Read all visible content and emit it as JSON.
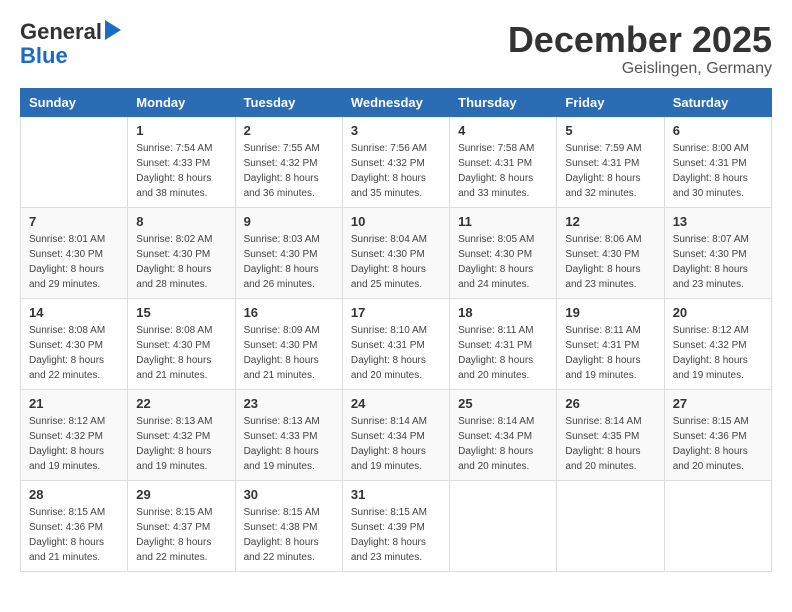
{
  "header": {
    "logo_general": "General",
    "logo_blue": "Blue",
    "month_title": "December 2025",
    "location": "Geislingen, Germany"
  },
  "days_of_week": [
    "Sunday",
    "Monday",
    "Tuesday",
    "Wednesday",
    "Thursday",
    "Friday",
    "Saturday"
  ],
  "weeks": [
    [
      {
        "day": "",
        "info": ""
      },
      {
        "day": "1",
        "info": "Sunrise: 7:54 AM\nSunset: 4:33 PM\nDaylight: 8 hours\nand 38 minutes."
      },
      {
        "day": "2",
        "info": "Sunrise: 7:55 AM\nSunset: 4:32 PM\nDaylight: 8 hours\nand 36 minutes."
      },
      {
        "day": "3",
        "info": "Sunrise: 7:56 AM\nSunset: 4:32 PM\nDaylight: 8 hours\nand 35 minutes."
      },
      {
        "day": "4",
        "info": "Sunrise: 7:58 AM\nSunset: 4:31 PM\nDaylight: 8 hours\nand 33 minutes."
      },
      {
        "day": "5",
        "info": "Sunrise: 7:59 AM\nSunset: 4:31 PM\nDaylight: 8 hours\nand 32 minutes."
      },
      {
        "day": "6",
        "info": "Sunrise: 8:00 AM\nSunset: 4:31 PM\nDaylight: 8 hours\nand 30 minutes."
      }
    ],
    [
      {
        "day": "7",
        "info": "Sunrise: 8:01 AM\nSunset: 4:30 PM\nDaylight: 8 hours\nand 29 minutes."
      },
      {
        "day": "8",
        "info": "Sunrise: 8:02 AM\nSunset: 4:30 PM\nDaylight: 8 hours\nand 28 minutes."
      },
      {
        "day": "9",
        "info": "Sunrise: 8:03 AM\nSunset: 4:30 PM\nDaylight: 8 hours\nand 26 minutes."
      },
      {
        "day": "10",
        "info": "Sunrise: 8:04 AM\nSunset: 4:30 PM\nDaylight: 8 hours\nand 25 minutes."
      },
      {
        "day": "11",
        "info": "Sunrise: 8:05 AM\nSunset: 4:30 PM\nDaylight: 8 hours\nand 24 minutes."
      },
      {
        "day": "12",
        "info": "Sunrise: 8:06 AM\nSunset: 4:30 PM\nDaylight: 8 hours\nand 23 minutes."
      },
      {
        "day": "13",
        "info": "Sunrise: 8:07 AM\nSunset: 4:30 PM\nDaylight: 8 hours\nand 23 minutes."
      }
    ],
    [
      {
        "day": "14",
        "info": "Sunrise: 8:08 AM\nSunset: 4:30 PM\nDaylight: 8 hours\nand 22 minutes."
      },
      {
        "day": "15",
        "info": "Sunrise: 8:08 AM\nSunset: 4:30 PM\nDaylight: 8 hours\nand 21 minutes."
      },
      {
        "day": "16",
        "info": "Sunrise: 8:09 AM\nSunset: 4:30 PM\nDaylight: 8 hours\nand 21 minutes."
      },
      {
        "day": "17",
        "info": "Sunrise: 8:10 AM\nSunset: 4:31 PM\nDaylight: 8 hours\nand 20 minutes."
      },
      {
        "day": "18",
        "info": "Sunrise: 8:11 AM\nSunset: 4:31 PM\nDaylight: 8 hours\nand 20 minutes."
      },
      {
        "day": "19",
        "info": "Sunrise: 8:11 AM\nSunset: 4:31 PM\nDaylight: 8 hours\nand 19 minutes."
      },
      {
        "day": "20",
        "info": "Sunrise: 8:12 AM\nSunset: 4:32 PM\nDaylight: 8 hours\nand 19 minutes."
      }
    ],
    [
      {
        "day": "21",
        "info": "Sunrise: 8:12 AM\nSunset: 4:32 PM\nDaylight: 8 hours\nand 19 minutes."
      },
      {
        "day": "22",
        "info": "Sunrise: 8:13 AM\nSunset: 4:32 PM\nDaylight: 8 hours\nand 19 minutes."
      },
      {
        "day": "23",
        "info": "Sunrise: 8:13 AM\nSunset: 4:33 PM\nDaylight: 8 hours\nand 19 minutes."
      },
      {
        "day": "24",
        "info": "Sunrise: 8:14 AM\nSunset: 4:34 PM\nDaylight: 8 hours\nand 19 minutes."
      },
      {
        "day": "25",
        "info": "Sunrise: 8:14 AM\nSunset: 4:34 PM\nDaylight: 8 hours\nand 20 minutes."
      },
      {
        "day": "26",
        "info": "Sunrise: 8:14 AM\nSunset: 4:35 PM\nDaylight: 8 hours\nand 20 minutes."
      },
      {
        "day": "27",
        "info": "Sunrise: 8:15 AM\nSunset: 4:36 PM\nDaylight: 8 hours\nand 20 minutes."
      }
    ],
    [
      {
        "day": "28",
        "info": "Sunrise: 8:15 AM\nSunset: 4:36 PM\nDaylight: 8 hours\nand 21 minutes."
      },
      {
        "day": "29",
        "info": "Sunrise: 8:15 AM\nSunset: 4:37 PM\nDaylight: 8 hours\nand 22 minutes."
      },
      {
        "day": "30",
        "info": "Sunrise: 8:15 AM\nSunset: 4:38 PM\nDaylight: 8 hours\nand 22 minutes."
      },
      {
        "day": "31",
        "info": "Sunrise: 8:15 AM\nSunset: 4:39 PM\nDaylight: 8 hours\nand 23 minutes."
      },
      {
        "day": "",
        "info": ""
      },
      {
        "day": "",
        "info": ""
      },
      {
        "day": "",
        "info": ""
      }
    ]
  ]
}
